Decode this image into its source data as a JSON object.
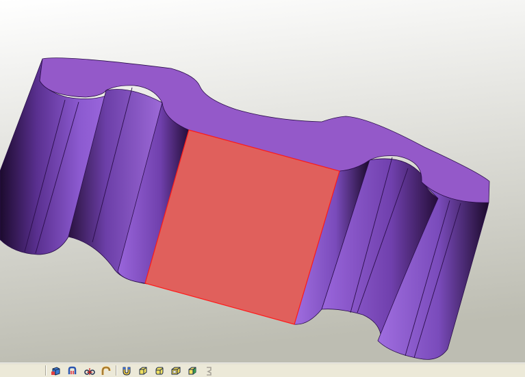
{
  "window": {
    "title": ""
  },
  "scene": {
    "background_top": "#ffffff",
    "background_bottom": "#bdbdb2",
    "body_color": "#8e5ccc",
    "top_face_color": "#9459c9",
    "edge_color": "#2a0e4a",
    "selected_face_color": "#e0605c",
    "selected_edge_color": "#ff1a1a"
  },
  "toolbar": {
    "buttons": [
      {
        "icon": "box-view-icon"
      },
      {
        "icon": "sweep-icon"
      },
      {
        "icon": "pipe-joint-icon"
      },
      {
        "icon": "hook-icon"
      },
      {
        "icon": "magnet-icon"
      },
      {
        "icon": "solid-box-icon"
      },
      {
        "icon": "solid-rounded-box-icon"
      },
      {
        "icon": "solid-box-alt-icon"
      },
      {
        "icon": "shaded-box-icon"
      },
      {
        "icon": "disabled-tool-icon"
      }
    ]
  }
}
